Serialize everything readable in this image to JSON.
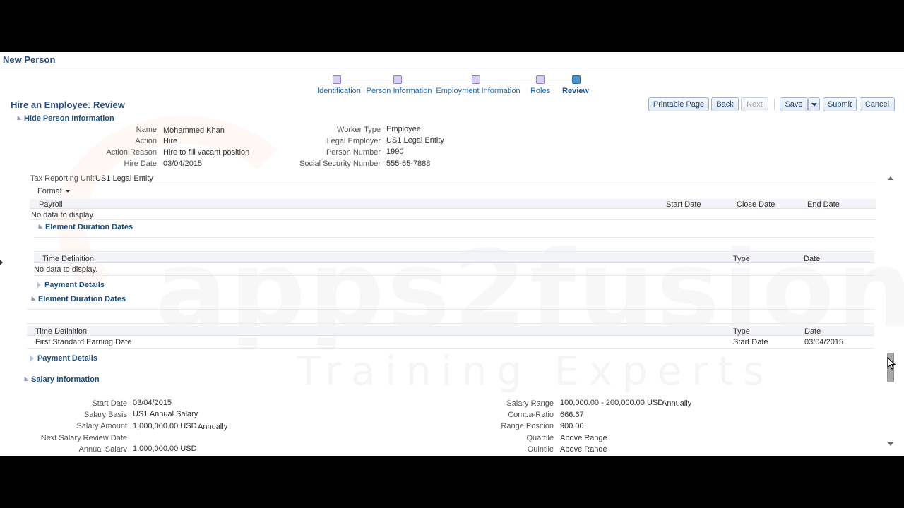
{
  "page_title": "New Person",
  "train": {
    "steps": [
      {
        "label": "Identification"
      },
      {
        "label": "Person Information"
      },
      {
        "label": "Employment Information"
      },
      {
        "label": "Roles"
      },
      {
        "label": "Review"
      }
    ],
    "current": "Review"
  },
  "review_title": "Hire an Employee: Review",
  "toolbar": {
    "printable": "Printable Page",
    "back": "Back",
    "next": "Next",
    "save": "Save",
    "submit": "Submit",
    "cancel": "Cancel"
  },
  "person_section": {
    "toggle": "Hide Person Information",
    "left": [
      {
        "label": "Name",
        "value": "Mohammed Khan"
      },
      {
        "label": "Action",
        "value": "Hire"
      },
      {
        "label": "Action Reason",
        "value": "Hire to fill vacant position"
      },
      {
        "label": "Hire Date",
        "value": "03/04/2015"
      }
    ],
    "right": [
      {
        "label": "Worker Type",
        "value": "Employee"
      },
      {
        "label": "Legal Employer",
        "value": "US1 Legal Entity"
      },
      {
        "label": "Person Number",
        "value": "1990"
      },
      {
        "label": "Social Security Number",
        "value": "555-55-7888"
      }
    ]
  },
  "scroll": {
    "tax_label": "Tax Reporting Unit",
    "tax_value": "US1 Legal Entity",
    "format_menu": "Format",
    "payroll_table": {
      "headers": [
        "Payroll",
        "Start Date",
        "Close Date",
        "End Date"
      ],
      "empty": "No data to display."
    },
    "element_dates_1": {
      "title": "Element Duration Dates",
      "headers": [
        "Time Definition",
        "Type",
        "Date"
      ],
      "empty": "No data to display."
    },
    "payment_details_1": "Payment Details",
    "element_dates_2": {
      "title": "Element Duration Dates",
      "headers": [
        "Time Definition",
        "Type",
        "Date"
      ],
      "row": [
        "First Standard Earning Date",
        "Start Date",
        "03/04/2015"
      ]
    },
    "payment_details_2": "Payment Details",
    "salary": {
      "title": "Salary Information",
      "left": [
        {
          "label": "Start Date",
          "value": "03/04/2015"
        },
        {
          "label": "Salary Basis",
          "value": "US1 Annual Salary"
        },
        {
          "label": "Salary Amount",
          "value": "1,000,000.00 USD",
          "extra": "Annually"
        },
        {
          "label": "Next Salary Review Date",
          "value": ""
        },
        {
          "label": "Annual Salary",
          "value": "1,000,000.00 USD"
        }
      ],
      "right": [
        {
          "label": "Salary Range",
          "value": "100,000.00 - 200,000.00 USD",
          "extra": "Annually"
        },
        {
          "label": "Compa-Ratio",
          "value": "666.67"
        },
        {
          "label": "Range Position",
          "value": "900.00"
        },
        {
          "label": "Quartile",
          "value": "Above Range"
        },
        {
          "label": "Quintile",
          "value": "Above Range"
        }
      ]
    }
  },
  "watermark": {
    "brand": "apps2fusion",
    "tagline": "Training Experts"
  }
}
